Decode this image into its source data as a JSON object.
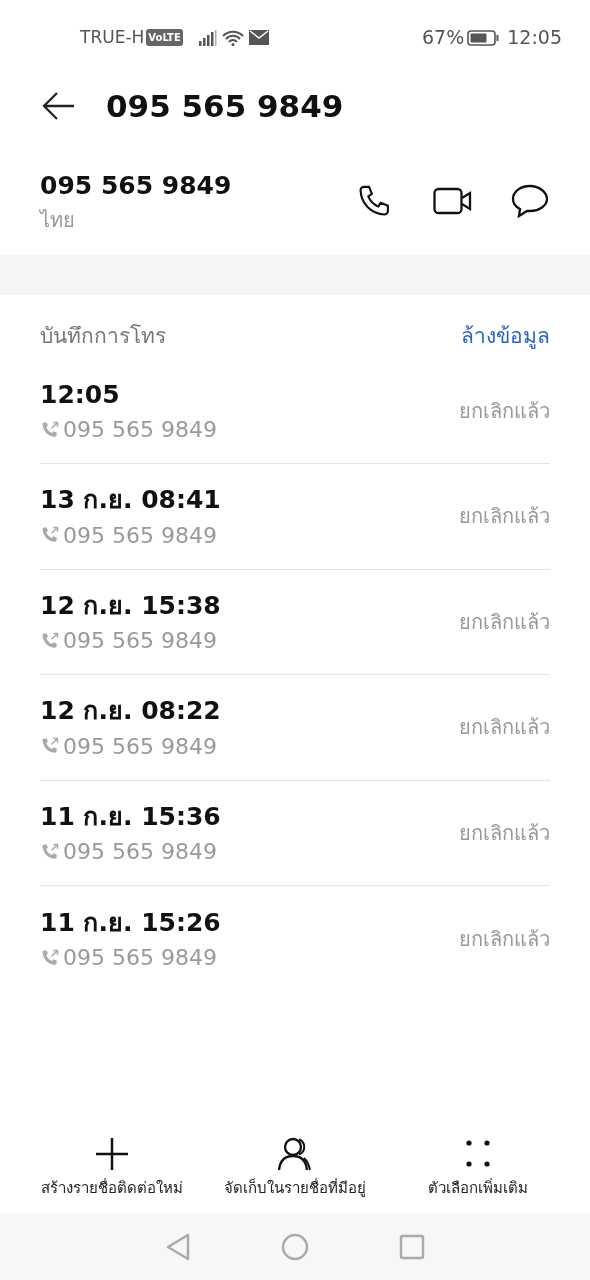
{
  "status_bar": {
    "carrier": "TRUE-H",
    "network_badge": "VoLTE",
    "battery": "67%",
    "time": "12:05"
  },
  "header": {
    "title": "095 565 9849"
  },
  "contact": {
    "number": "095 565 9849",
    "location": "ไทย"
  },
  "call_log": {
    "title": "บันทึกการโทร",
    "clear_link": "ล้างข้อมูล",
    "entries": [
      {
        "time": "12:05",
        "number": "095 565 9849",
        "status": "ยกเลิกแล้ว"
      },
      {
        "time": "13 ก.ย. 08:41",
        "number": "095 565 9849",
        "status": "ยกเลิกแล้ว"
      },
      {
        "time": "12 ก.ย. 15:38",
        "number": "095 565 9849",
        "status": "ยกเลิกแล้ว"
      },
      {
        "time": "12 ก.ย. 08:22",
        "number": "095 565 9849",
        "status": "ยกเลิกแล้ว"
      },
      {
        "time": "11 ก.ย. 15:36",
        "number": "095 565 9849",
        "status": "ยกเลิกแล้ว"
      },
      {
        "time": "11 ก.ย. 15:26",
        "number": "095 565 9849",
        "status": "ยกเลิกแล้ว"
      }
    ]
  },
  "actions": [
    {
      "kind": "add",
      "label": "สร้างรายชื่อติดต่อใหม่"
    },
    {
      "kind": "contacts",
      "label": "จัดเก็บในรายชื่อที่มีอยู่"
    },
    {
      "kind": "more",
      "label": "ตัวเลือกเพิ่มเติม"
    }
  ]
}
